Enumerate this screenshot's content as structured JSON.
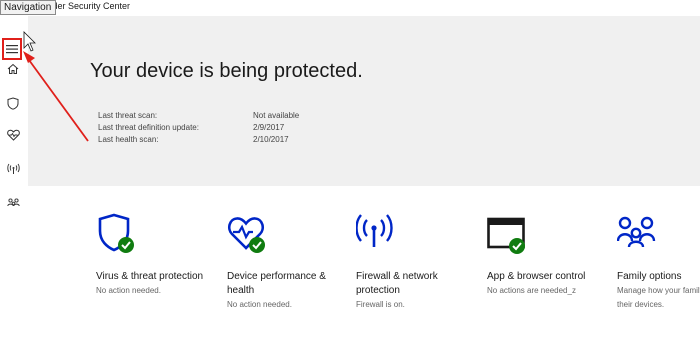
{
  "window": {
    "title": "fender Security Center",
    "tooltip": "Navigation"
  },
  "colors": {
    "accent": "#0026c7",
    "check": "#107c10",
    "annotation": "#e0201b",
    "hero_bg": "#f0f0f0"
  },
  "sidebar": {
    "items": [
      {
        "icon": "hamburger-menu-icon"
      },
      {
        "icon": "home-icon"
      },
      {
        "icon": "shield-icon"
      },
      {
        "icon": "heart-pulse-icon"
      },
      {
        "icon": "wireless-antenna-icon"
      },
      {
        "icon": "family-icon"
      }
    ]
  },
  "hero": {
    "title": "Your device is being protected.",
    "rows": [
      {
        "label": "Last threat scan:",
        "value": "Not available"
      },
      {
        "label": "Last threat definition update:",
        "value": "2/9/2017"
      },
      {
        "label": "Last health scan:",
        "value": "2/10/2017"
      }
    ]
  },
  "cards": [
    {
      "icon": "shield-check-icon",
      "title": "Virus & threat protection",
      "status": "No action needed."
    },
    {
      "icon": "heart-check-icon",
      "title": "Device performance & health",
      "status": "No action needed."
    },
    {
      "icon": "antenna-icon",
      "title": "Firewall & network protection",
      "status": "Firewall is on."
    },
    {
      "icon": "browser-window-icon",
      "title": "App & browser control",
      "status": "No actions are needed_z"
    },
    {
      "icon": "people-icon",
      "title": "Family options",
      "status": "Manage how your family uses their devices."
    }
  ]
}
